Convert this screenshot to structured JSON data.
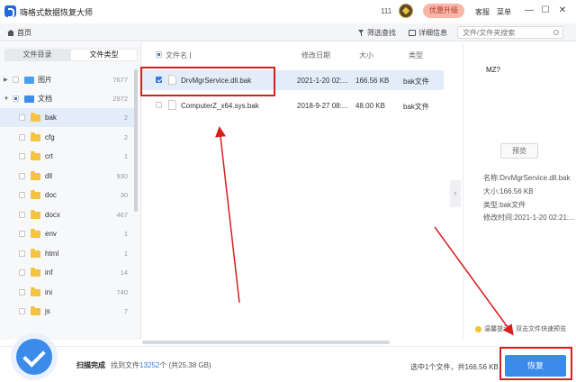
{
  "app": {
    "title": "嗨格式数据恢复大师"
  },
  "titlebar": {
    "count": "111",
    "upgrade": "优惠升级",
    "service": "客服",
    "menu": "菜单",
    "minimize": "—",
    "maximize": "☐",
    "close": "✕"
  },
  "toolbar": {
    "home": "首页",
    "filter": "筛选查找",
    "details": "详细信息",
    "search_placeholder": "文件/文件夹搜索"
  },
  "left_panel": {
    "tabs": [
      {
        "label": "文件目录",
        "active": false
      },
      {
        "label": "文件类型",
        "active": true
      }
    ],
    "tree": [
      {
        "label": "图片",
        "count": "7677",
        "level": 0,
        "icon": "image-icon"
      },
      {
        "label": "文档",
        "count": "2972",
        "level": 0,
        "icon": "document-folder-icon",
        "expanded": true
      },
      {
        "label": "bak",
        "count": "2",
        "level": 1,
        "icon": "folder-icon",
        "selected": true
      },
      {
        "label": "cfg",
        "count": "2",
        "level": 1,
        "icon": "folder-icon"
      },
      {
        "label": "crt",
        "count": "1",
        "level": 1,
        "icon": "folder-icon"
      },
      {
        "label": "dll",
        "count": "930",
        "level": 1,
        "icon": "folder-icon"
      },
      {
        "label": "doc",
        "count": "30",
        "level": 1,
        "icon": "folder-icon"
      },
      {
        "label": "docx",
        "count": "467",
        "level": 1,
        "icon": "folder-icon"
      },
      {
        "label": "env",
        "count": "1",
        "level": 1,
        "icon": "folder-icon"
      },
      {
        "label": "html",
        "count": "1",
        "level": 1,
        "icon": "folder-icon"
      },
      {
        "label": "inf",
        "count": "14",
        "level": 1,
        "icon": "folder-icon"
      },
      {
        "label": "ini",
        "count": "740",
        "level": 1,
        "icon": "folder-icon"
      },
      {
        "label": "js",
        "count": "7",
        "level": 1,
        "icon": "folder-icon"
      }
    ]
  },
  "file_list": {
    "headers": {
      "name": "文件名",
      "modified": "修改日期",
      "size": "大小",
      "type": "类型"
    },
    "rows": [
      {
        "name": "DrvMgrService.dll.bak",
        "modified": "2021-1-20 02:...",
        "size": "166.56 KB",
        "type": "bak文件",
        "checked": true
      },
      {
        "name": "ComputerZ_x64.sys.bak",
        "modified": "2018-9-27 08:...",
        "size": "48.00 KB",
        "type": "bak文件",
        "checked": false
      }
    ]
  },
  "preview": {
    "content": "MZ?",
    "button": "预览",
    "info": [
      "名称:DrvMgrService.dll.bak",
      "大小:166.56 KB",
      "类型:bak文件",
      "修改时间:2021-1-20 02:21:..."
    ],
    "tip": "温馨提示：双击文件快速预览"
  },
  "footer": {
    "scan_done": "扫描完成",
    "found_prefix": "找到文件",
    "found_count": "13252",
    "found_suffix": "个  (共25.38 GB)",
    "selection_summary": "选中1个文件，共166.56 KB",
    "recover": "恢复"
  },
  "colors": {
    "accent": "#3a8bea",
    "annotation": "#d61f1f",
    "upgrade_bg": "#f7b6a6"
  }
}
